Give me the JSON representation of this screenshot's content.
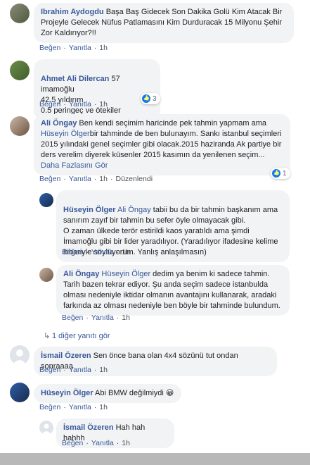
{
  "actions": {
    "like": "Beğen",
    "reply": "Yanıtla",
    "sep": "·",
    "edited": "Düzenlendi"
  },
  "comments": [
    {
      "name": "Ibrahim Aydogdu",
      "text": "Başa Baş Gidecek Son Dakika Golü Kim Atacak Bir Projeyle Gelecek Nüfus Patlamasını Kim Durduracak 15 Milyonu Şehir Zor Kaldırıyor?!!",
      "time": "1h"
    },
    {
      "name": "Ahmet Ali Dilercan",
      "text": "57 imamoğlu\n42.5 yıldırım\n0.5 peringeç ve ötekiler",
      "time": "1h",
      "reactions": "3"
    },
    {
      "name": "Ali Öngay",
      "text": "Ben kendi seçimim haricinde pek tahmin yapmam ama",
      "mention": "Hüseyin Ölger",
      "text2": "bir tahminde de ben bulunayım. Sankı istanbul seçimleri 2015 yılındaki genel seçimler gibi olacak.2015 haziranda Ak partiye bir ders verelim diyerek küsenler 2015 kasımın da yenilenen seçim...",
      "more": "Daha Fazlasını Gör",
      "time": "1h",
      "reactions": "1"
    },
    {
      "name": "Hüseyin Ölger",
      "mention": "Ali Öngay",
      "text": "tabii bu da bir tahmin başkanım ama sanırım zayıf bir tahmin bu sefer öyle olmayacak gibi.\nO zaman ülkede terör estirildi kaos yaratıldı ama şimdi İmamoğlu gibi bir lider yaradılıyor. (Yaradılıyor ifadesine kelime itibariyle söylüyorum. Yanlış anlaşılmasın)",
      "time": "1h"
    },
    {
      "name": "Ali Öngay",
      "mention": "Hüseyin Ölger",
      "text": "dedim ya benim ki sadece tahmin. Tarih bazen tekrar ediyor. Şu anda seçim sadece istanbulda olması nedeniyle iktidar olmanın avantajını kullanarak, aradaki farkında az olması nedeniyle ben böyle bir tahminde bulundum.",
      "time": "1h"
    },
    {
      "more_replies": "1 diğer yanıtı gör"
    },
    {
      "name": "İsmail Özeren",
      "text": "Sen önce bana olan 4x4 sözünü tut ondan sonraaaa",
      "time": "1h"
    },
    {
      "name": "Hüseyin Ölger",
      "text": "Abi BMW değilmiydi 😀",
      "time": "1h"
    },
    {
      "name": "İsmail Özeren",
      "text": "Hah hah hahhh",
      "time": "1h"
    }
  ]
}
